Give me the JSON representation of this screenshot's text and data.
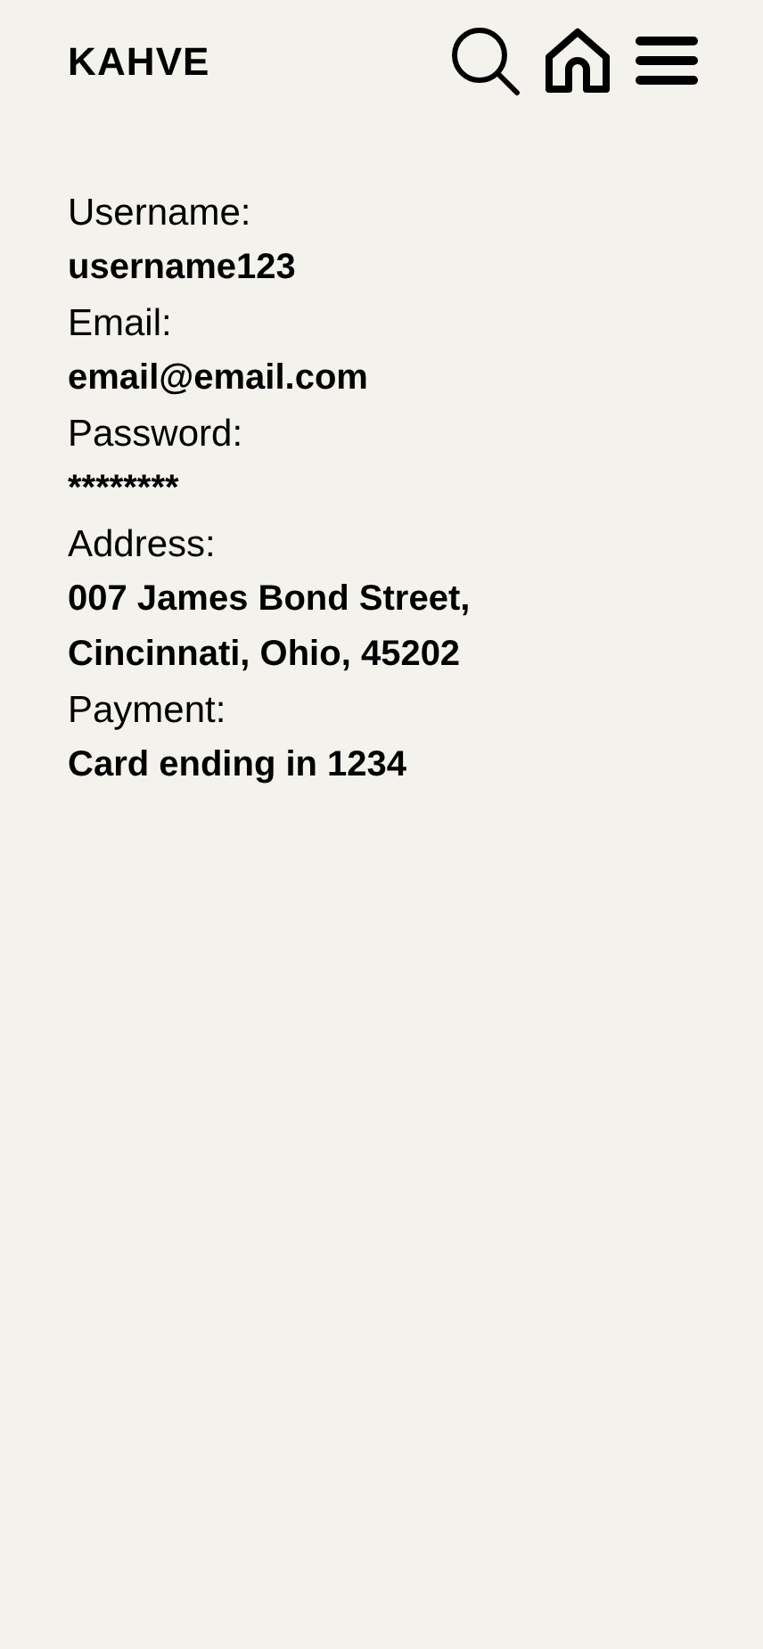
{
  "header": {
    "logo": "KAHVE"
  },
  "fields": [
    {
      "label": "Username:",
      "value": "username123"
    },
    {
      "label": "Email:",
      "value": "email@email.com"
    },
    {
      "label": "Password:",
      "value": "********"
    },
    {
      "label": "Address:",
      "value": "007 James Bond Street, Cincinnati, Ohio, 45202"
    },
    {
      "label": "Payment:",
      "value": "Card ending in 1234"
    }
  ]
}
